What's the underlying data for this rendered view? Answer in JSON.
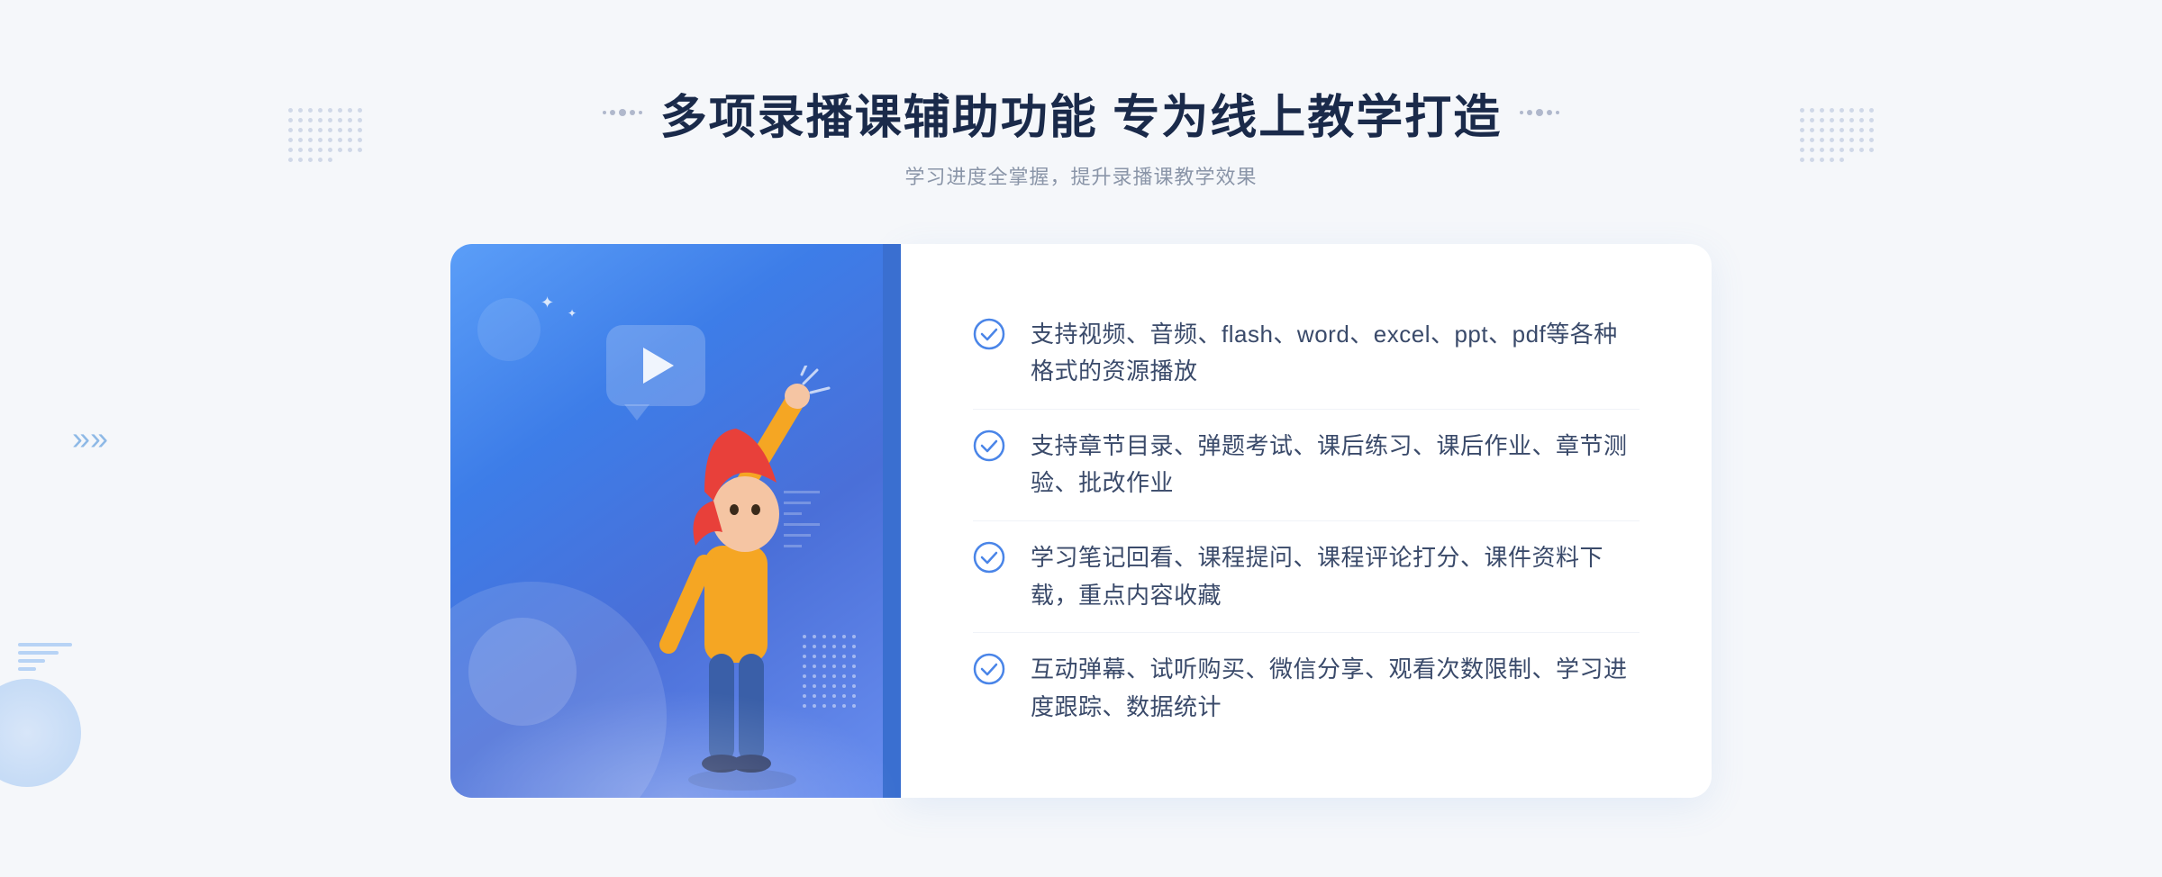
{
  "header": {
    "title": "多项录播课辅助功能 专为线上教学打造",
    "subtitle": "学习进度全掌握，提升录播课教学效果"
  },
  "features": [
    {
      "id": "feature-1",
      "text": "支持视频、音频、flash、word、excel、ppt、pdf等各种格式的资源播放"
    },
    {
      "id": "feature-2",
      "text": "支持章节目录、弹题考试、课后练习、课后作业、章节测验、批改作业"
    },
    {
      "id": "feature-3",
      "text": "学习笔记回看、课程提问、课程评论打分、课件资料下载，重点内容收藏"
    },
    {
      "id": "feature-4",
      "text": "互动弹幕、试听购买、微信分享、观看次数限制、学习进度跟踪、数据统计"
    }
  ],
  "icons": {
    "check": "check-circle-icon",
    "play": "play-icon",
    "arrow_left": "«",
    "arrow_right": "»"
  },
  "colors": {
    "primary_blue": "#4a85e8",
    "light_blue": "#7ab0f5",
    "title_dark": "#1a2a4a",
    "text_gray": "#8a95a8",
    "feature_text": "#3a4a6a"
  }
}
